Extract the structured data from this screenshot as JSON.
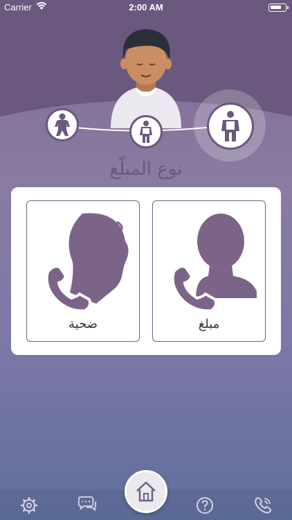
{
  "status_bar": {
    "carrier": "Carrier",
    "time": "2:00 AM"
  },
  "page_title": "نوع المبلّغ",
  "cards": {
    "victim_label": "ضحية",
    "reporter_label": "مبلغ"
  },
  "steps": {
    "selected_index": 3
  },
  "icons": {
    "step1": "child-figure-icon",
    "step2": "teen-figure-icon",
    "step3": "adult-figure-icon",
    "victim": "child-phone-icon",
    "reporter": "adult-phone-icon",
    "tab_settings": "gear-icon",
    "tab_chat": "chat-bubbles-icon",
    "tab_home": "home-icon",
    "tab_help": "question-icon",
    "tab_call": "phone-icon"
  },
  "colors": {
    "accent": "#6f5e83",
    "header": "#6b587e"
  }
}
